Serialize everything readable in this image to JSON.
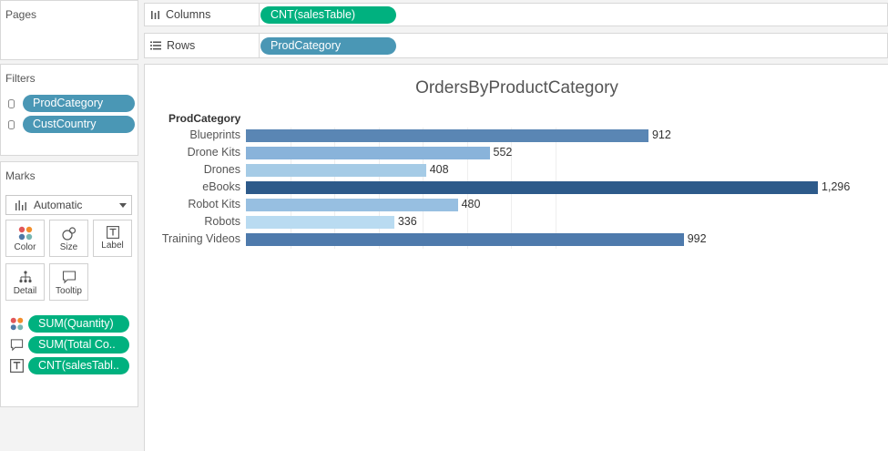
{
  "pages": {
    "title": "Pages"
  },
  "shelves": {
    "columns": {
      "label": "Columns",
      "pill": "CNT(salesTable)"
    },
    "rows": {
      "label": "Rows",
      "pill": "ProdCategory"
    }
  },
  "filters": {
    "title": "Filters",
    "items": [
      "ProdCategory",
      "CustCountry"
    ]
  },
  "marks": {
    "title": "Marks",
    "type": "Automatic",
    "buttons": [
      "Color",
      "Size",
      "Label",
      "Detail",
      "Tooltip"
    ],
    "fields": [
      {
        "icon": "color-icon",
        "label": "SUM(Quantity)"
      },
      {
        "icon": "tooltip-icon",
        "label": "SUM(Total Co.."
      },
      {
        "icon": "label-icon",
        "label": "CNT(salesTabl.."
      }
    ]
  },
  "chart_data": {
    "type": "bar",
    "orientation": "horizontal",
    "title": "OrdersByProductCategory",
    "row_header": "ProdCategory",
    "categories": [
      "Blueprints",
      "Drone Kits",
      "Drones",
      "eBooks",
      "Robot Kits",
      "Robots",
      "Training Videos"
    ],
    "values": [
      912,
      552,
      408,
      1296,
      480,
      336,
      992
    ],
    "value_labels": [
      "912",
      "552",
      "408",
      "1,296",
      "480",
      "336",
      "992"
    ],
    "colors": [
      "#5a86b4",
      "#89b3da",
      "#a5cbe6",
      "#2d5a8a",
      "#97bfe1",
      "#b9dbf1",
      "#4e7aac"
    ],
    "xlim": [
      0,
      1300
    ],
    "grid": true
  }
}
